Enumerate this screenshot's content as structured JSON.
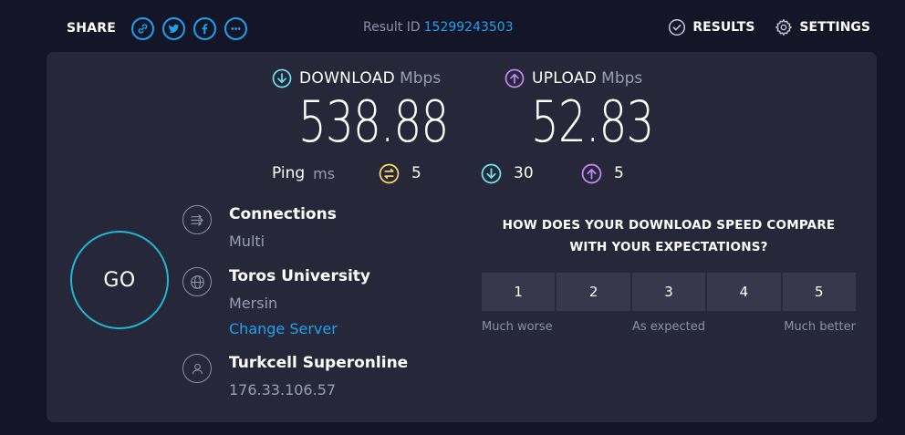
{
  "share": {
    "label": "SHARE",
    "icons": [
      "link-icon",
      "twitter-icon",
      "facebook-icon",
      "more-icon"
    ]
  },
  "result": {
    "label": "Result ID",
    "id": "15299243503"
  },
  "nav": {
    "results_label": "RESULTS",
    "settings_label": "SETTINGS"
  },
  "download": {
    "label": "DOWNLOAD",
    "unit": "Mbps",
    "value": "538.88"
  },
  "upload": {
    "label": "UPLOAD",
    "unit": "Mbps",
    "value": "52.83"
  },
  "ping": {
    "label": "Ping",
    "unit": "ms",
    "idle": "5",
    "download": "30",
    "upload": "5"
  },
  "go_label": "GO",
  "connections": {
    "title": "Connections",
    "value": "Multi"
  },
  "server": {
    "name": "Toros University",
    "location": "Mersin",
    "change_label": "Change Server"
  },
  "provider": {
    "name": "Turkcell Superonline",
    "ip": "176.33.106.57"
  },
  "survey": {
    "question_line1": "HOW DOES YOUR DOWNLOAD SPEED COMPARE",
    "question_line2": "WITH YOUR EXPECTATIONS?",
    "options": [
      "1",
      "2",
      "3",
      "4",
      "5"
    ],
    "label_low": "Much worse",
    "label_mid": "As expected",
    "label_high": "Much better"
  },
  "colors": {
    "background": "#141526",
    "panel": "#262839",
    "accent_blue": "#1da1f2",
    "download_cyan": "#6ae0e8",
    "upload_purple": "#c387f7",
    "ping_yellow": "#f5d564",
    "go_ring": "#1fb7d6"
  }
}
